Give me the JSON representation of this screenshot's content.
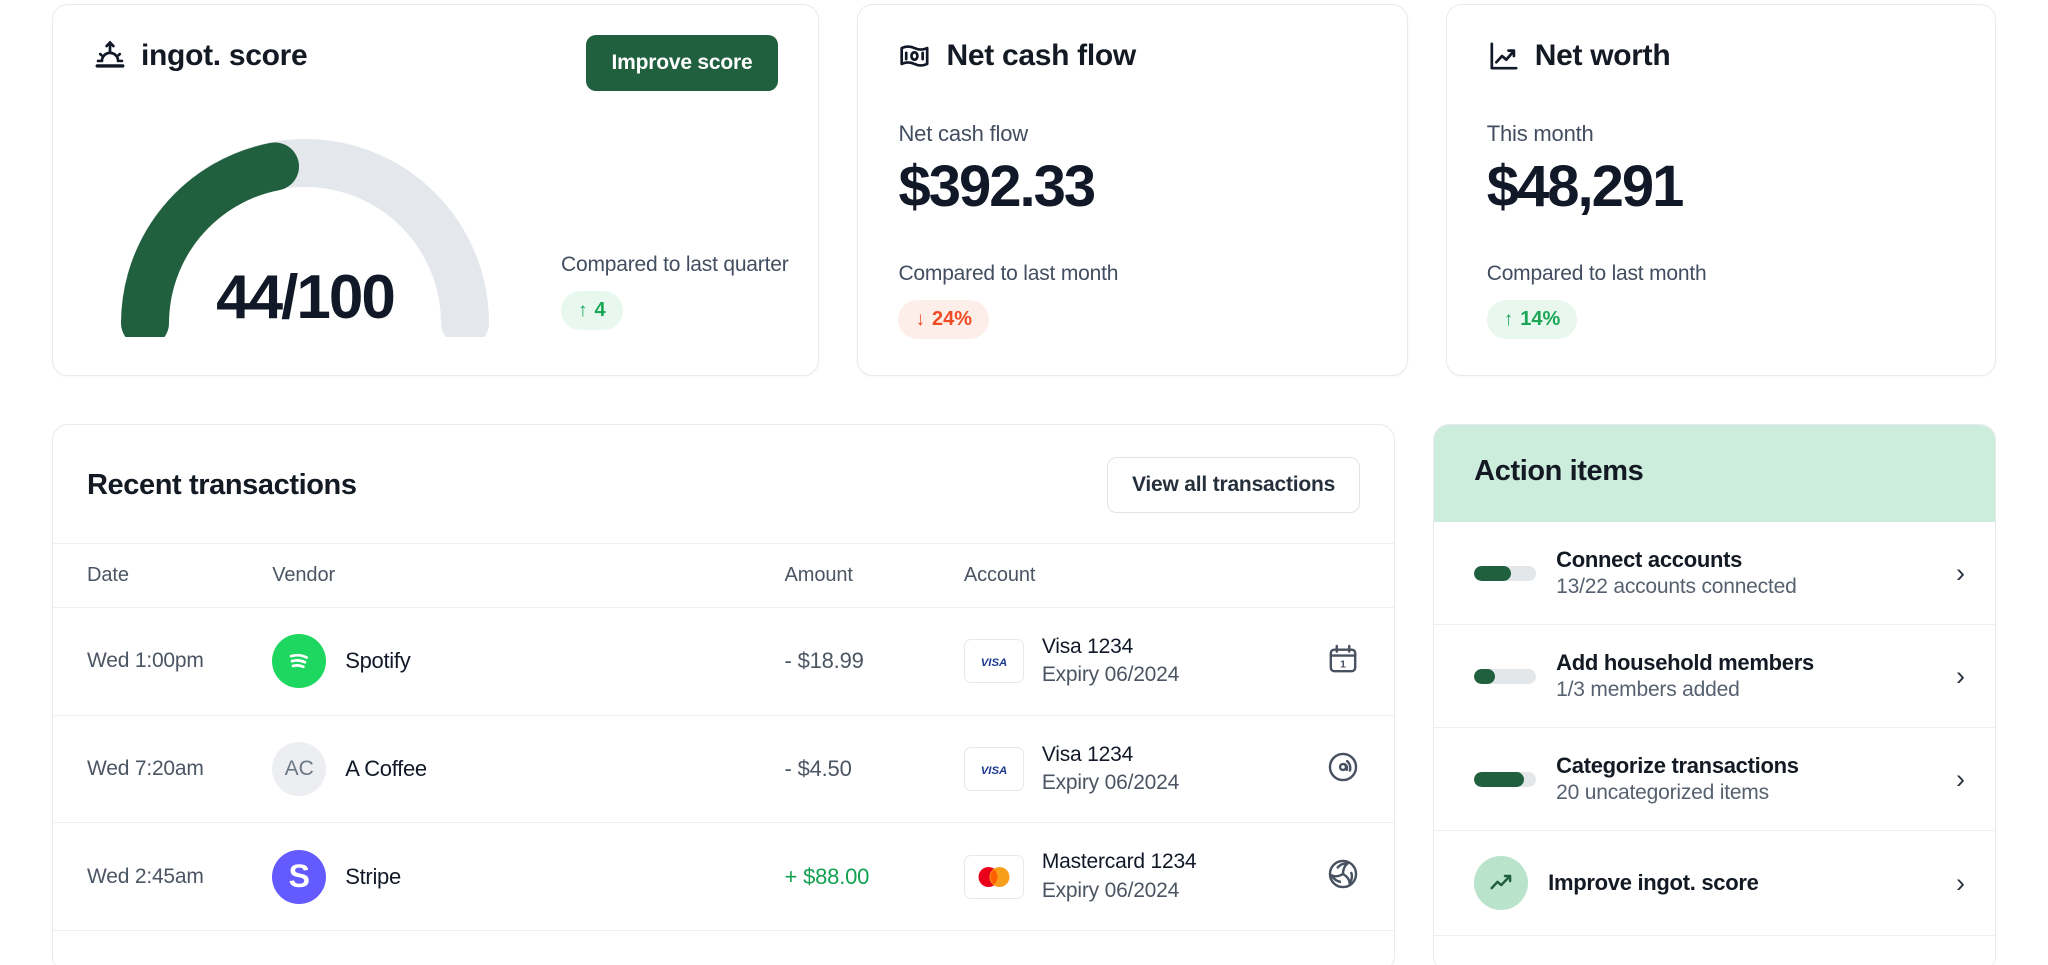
{
  "score_card": {
    "title": "ingot. score",
    "icon": "sunrise-icon",
    "improve_label": "Improve score",
    "score_text": "44/100",
    "score_value": 44,
    "score_max": 100,
    "compare_label": "Compared to last quarter",
    "delta": "4",
    "delta_direction": "up",
    "arrow_up": "↑",
    "accent_green": "#20603f",
    "track_gray": "#e4e8ed"
  },
  "cash_card": {
    "title": "Net cash flow",
    "icon": "banknote-icon",
    "sub_label": "Net cash flow",
    "value": "$392.33",
    "compare_label": "Compared to last month",
    "delta": "24%",
    "delta_direction": "down",
    "arrow_down": "↓",
    "badge_color": "#f04b23"
  },
  "worth_card": {
    "title": "Net worth",
    "icon": "trend-up-chart-icon",
    "sub_label": "This month",
    "value": "$48,291",
    "compare_label": "Compared to last month",
    "delta": "14%",
    "delta_direction": "up",
    "arrow_up": "↑",
    "badge_color": "#1ba556"
  },
  "transactions": {
    "title": "Recent transactions",
    "view_all_label": "View all transactions",
    "columns": [
      "Date",
      "Vendor",
      "Amount",
      "Account"
    ],
    "rows": [
      {
        "date": "Wed 1:00pm",
        "vendor": "Spotify",
        "avatar_kind": "spotify",
        "avatar_text": "",
        "amount": "- $18.99",
        "amount_sign": "negative",
        "card_brand": "visa",
        "account_name": "Visa 1234",
        "account_expiry": "Expiry 06/2024",
        "row_icon": "calendar-icon"
      },
      {
        "date": "Wed 7:20am",
        "vendor": "A Coffee",
        "avatar_kind": "initials",
        "avatar_text": "AC",
        "amount": "- $4.50",
        "amount_sign": "negative",
        "card_brand": "visa",
        "account_name": "Visa 1234",
        "account_expiry": "Expiry 06/2024",
        "row_icon": "disc-icon"
      },
      {
        "date": "Wed 2:45am",
        "vendor": "Stripe",
        "avatar_kind": "stripe",
        "avatar_text": "S",
        "amount": "+ $88.00",
        "amount_sign": "positive",
        "card_brand": "mastercard",
        "account_name": "Mastercard 1234",
        "account_expiry": "Expiry 06/2024",
        "row_icon": "pinwheel-icon"
      }
    ]
  },
  "action_items": {
    "title": "Action items",
    "chevron": "›",
    "items": [
      {
        "name": "Connect accounts",
        "sub": "13/22 accounts connected",
        "progress": 59,
        "kind": "progress"
      },
      {
        "name": "Add household members",
        "sub": "1/3 members added",
        "progress": 33,
        "kind": "progress"
      },
      {
        "name": "Categorize transactions",
        "sub": "20 uncategorized items",
        "progress": 80,
        "kind": "progress"
      },
      {
        "name": "Improve ingot. score",
        "sub": "",
        "progress": 0,
        "kind": "badge"
      }
    ]
  }
}
